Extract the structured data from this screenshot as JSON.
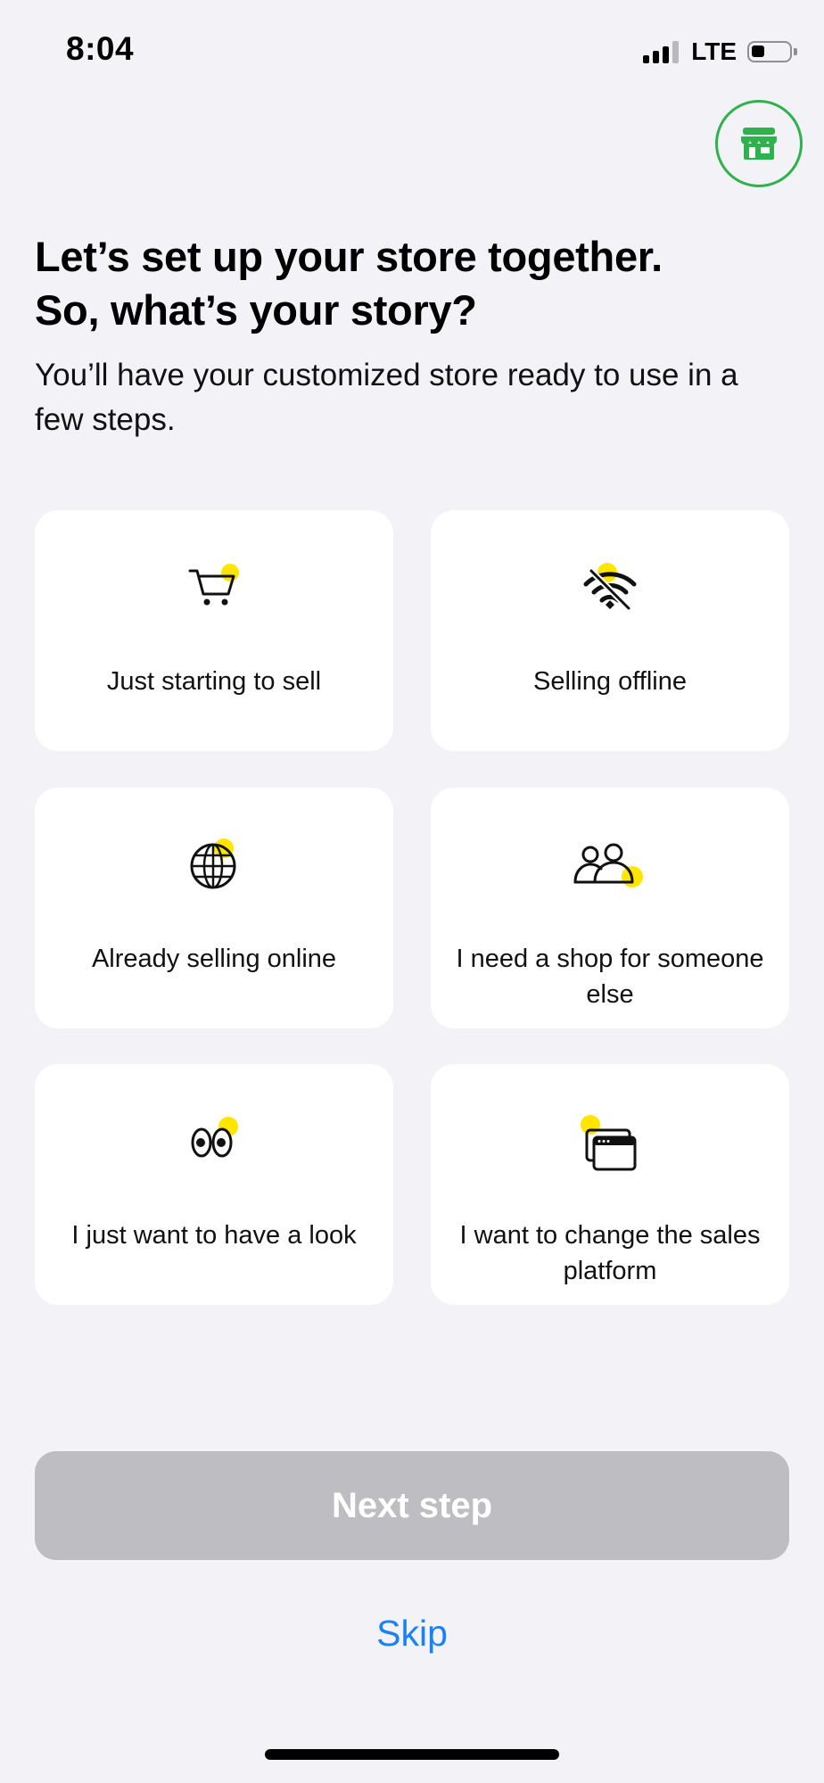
{
  "status_bar": {
    "time": "8:04",
    "network": "LTE"
  },
  "header": {
    "store_badge_icon": "storefront-icon",
    "accent_color": "#2db24c"
  },
  "main": {
    "title_line1": "Let’s set up your store together.",
    "title_line2": "So, what’s your story?",
    "subtitle": "You’ll have your customized store ready to use in a few steps.",
    "highlight_color": "#ffe500",
    "options": [
      {
        "label": "Just starting to sell",
        "icon": "shopping-cart-icon"
      },
      {
        "label": "Selling offline",
        "icon": "wifi-off-icon"
      },
      {
        "label": "Already selling online",
        "icon": "globe-icon"
      },
      {
        "label": "I need a shop for someone else",
        "icon": "people-icon"
      },
      {
        "label": "I just want to have a look",
        "icon": "eyes-icon"
      },
      {
        "label": "I want to change the sales platform",
        "icon": "browser-windows-icon"
      }
    ]
  },
  "footer": {
    "next_label": "Next step",
    "skip_label": "Skip",
    "link_color": "#1a82f5"
  }
}
